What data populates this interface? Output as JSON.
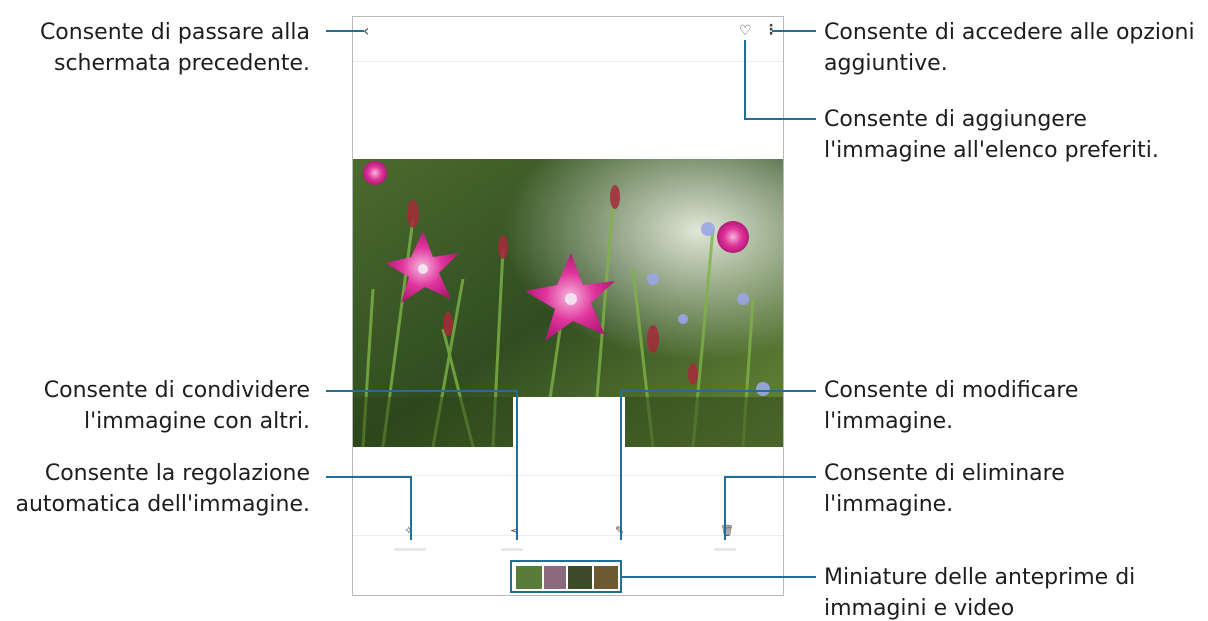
{
  "callouts": {
    "back": [
      "Consente di passare alla",
      "schermata precedente."
    ],
    "more_options": [
      "Consente di accedere alle opzioni",
      "aggiuntive."
    ],
    "favorite": [
      "Consente di aggiungere",
      "l'immagine all'elenco preferiti."
    ],
    "share": [
      "Consente di condividere",
      "l'immagine con altri."
    ],
    "edit": [
      "Consente di modificare",
      "l'immagine."
    ],
    "auto_adjust": [
      "Consente la regolazione",
      "automatica dell'immagine."
    ],
    "delete": [
      "Consente di eliminare",
      "l'immagine."
    ],
    "thumbnails": [
      "Miniature delle anteprime di",
      "immagini e video"
    ]
  },
  "icons": {
    "back": "chevron-left-icon",
    "favorite": "heart-icon",
    "more": "more-vertical-icon",
    "auto_adjust": "magic-wand-icon",
    "share": "share-icon",
    "edit": "pencil-icon",
    "delete": "trash-icon"
  },
  "colors": {
    "leader_line": "#1f6f99",
    "device_border": "#b9b9b9",
    "text": "#1d1d1b"
  }
}
